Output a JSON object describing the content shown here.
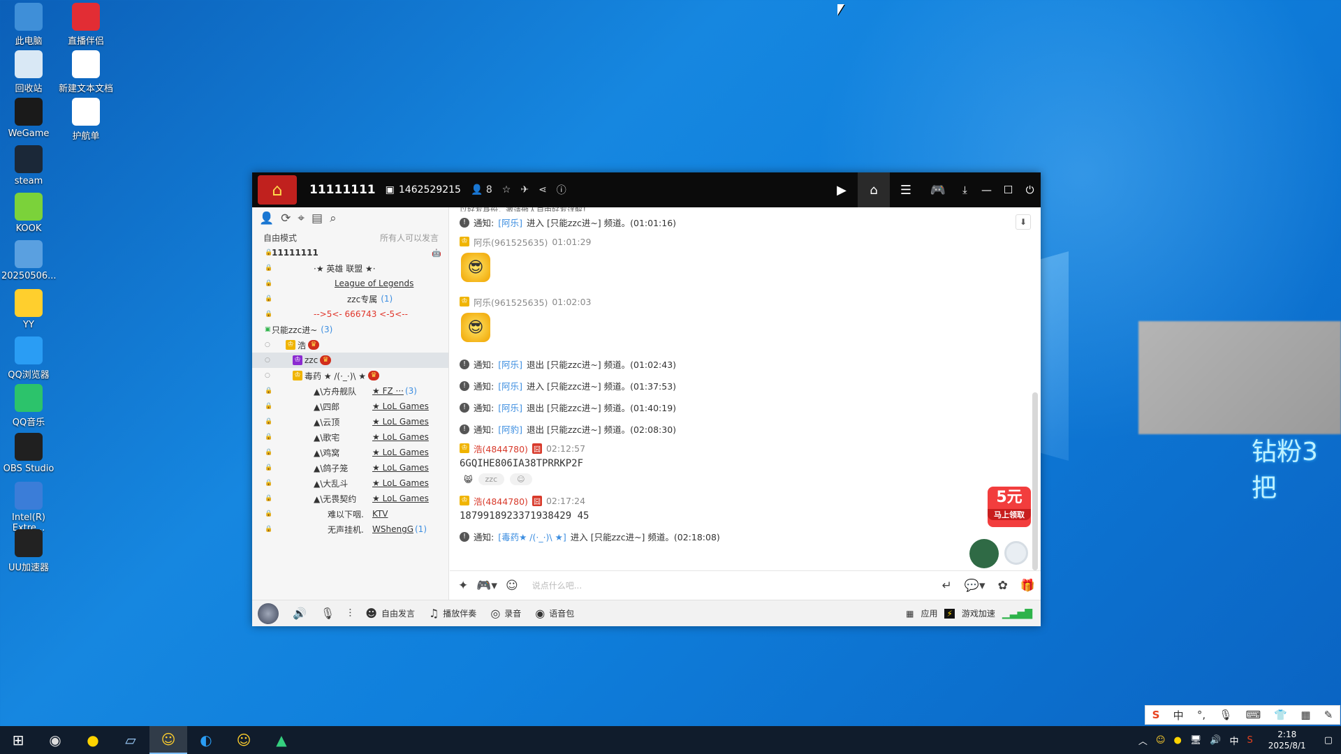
{
  "desktop": {
    "icons": [
      {
        "label": "此电脑",
        "icon": "computer-icon",
        "color": "#3f8fd8"
      },
      {
        "label": "直播伴侣",
        "icon": "live-companion-icon",
        "color": "#e22d34"
      },
      {
        "label": "回收站",
        "icon": "recycle-bin-icon",
        "color": "#d9e8f5"
      },
      {
        "label": "新建文本文档",
        "icon": "text-document-icon",
        "color": "#ffffff"
      },
      {
        "label": "WeGame",
        "icon": "wegame-icon",
        "color": "#1a1a1a"
      },
      {
        "label": "护航单",
        "icon": "text-document-icon",
        "color": "#ffffff"
      },
      {
        "label": "steam",
        "icon": "steam-icon",
        "color": "#1b2838"
      },
      {
        "label": "KOOK",
        "icon": "kook-icon",
        "color": "#7bd23a"
      },
      {
        "label": "20250506...",
        "icon": "folder-icon",
        "color": "#5aa0e0"
      },
      {
        "label": "YY",
        "icon": "yy-icon",
        "color": "#ffcf2d"
      },
      {
        "label": "QQ浏览器",
        "icon": "qq-browser-icon",
        "color": "#2a9df4"
      },
      {
        "label": "QQ音乐",
        "icon": "qq-music-icon",
        "color": "#2cc36b"
      },
      {
        "label": "OBS Studio",
        "icon": "obs-icon",
        "color": "#202020"
      },
      {
        "label": "Intel(R) Extre...",
        "icon": "intel-icon",
        "color": "#3b7dd8"
      },
      {
        "label": "UU加速器",
        "icon": "uu-accelerator-icon",
        "color": "#222222"
      }
    ],
    "side_text": "钻粉3把"
  },
  "window": {
    "room_name": "11111111",
    "room_id": "1462529215",
    "member_count": "8",
    "left": {
      "mode": "自由模式",
      "mode_note": "所有人可以发言",
      "channels": [
        {
          "text": "11111111",
          "bold": true,
          "indent": 0
        },
        {
          "text": "·★   英雄 联盟   ★·",
          "indent": 60
        },
        {
          "text": "League of Legends",
          "underline": true,
          "indent": 90
        },
        {
          "text": "zzc专属",
          "count": "(1)",
          "indent": 108
        },
        {
          "text": "-->5<-   666743   <-5<--",
          "red": true,
          "indent": 60
        },
        {
          "text": "只能zzc进~",
          "count": "(3)",
          "indent": 0,
          "folder": true
        },
        {
          "text": "浩",
          "indent": 20,
          "user": "king"
        },
        {
          "text": "zzc",
          "indent": 30,
          "user": "purple",
          "selected": true
        },
        {
          "text": "毒药 ★ /(·_·)\\ ★",
          "indent": 30,
          "user": "king"
        },
        {
          "text": "▲\\方舟舰队",
          "right": "★ FZ ···",
          "count": "(3)",
          "indent": 60
        },
        {
          "text": "▲\\四郎",
          "right": "★ LoL Games",
          "indent": 60
        },
        {
          "text": "▲\\云顶",
          "right": "★ LoL Games",
          "indent": 60
        },
        {
          "text": "▲\\歌宅",
          "right": "★ LoL Games",
          "indent": 60
        },
        {
          "text": "▲\\鸡窝",
          "right": "★ LoL Games",
          "indent": 60
        },
        {
          "text": "▲\\鸽子笼",
          "right": "★ LoL Games",
          "indent": 60
        },
        {
          "text": "▲\\大乱斗",
          "right": "★ LoL Games",
          "indent": 60
        },
        {
          "text": "▲\\无畏契约",
          "right": "★ LoL Games",
          "indent": 60
        },
        {
          "text": "难以下咽.",
          "right": "KTV",
          "indent": 80
        },
        {
          "text": "无声挂机.",
          "right": "WShengG",
          "count": "(1)",
          "indent": 80
        }
      ]
    },
    "chat": {
      "top_cut": "以好友身份，邀请他人自由好友详解！",
      "messages": [
        {
          "type": "sys",
          "label": "通知:",
          "user": "[阿乐]",
          "action": "进入 [只能zzc进~] 频道。(01:01:16)"
        },
        {
          "type": "user",
          "name": "阿乐(961525635)",
          "time": "01:01:29",
          "emoji": true
        },
        {
          "type": "user",
          "name": "阿乐(961525635)",
          "time": "01:02:03",
          "emoji": true
        },
        {
          "type": "sys",
          "label": "通知:",
          "user": "[阿乐]",
          "action": "退出 [只能zzc进~] 频道。(01:02:43)"
        },
        {
          "type": "sys",
          "label": "通知:",
          "user": "[阿乐]",
          "action": "进入 [只能zzc进~] 频道。(01:37:53)"
        },
        {
          "type": "sys",
          "label": "通知:",
          "user": "[阿乐]",
          "action": "退出 [只能zzc进~] 频道。(01:40:19)"
        },
        {
          "type": "sys",
          "label": "通知:",
          "user": "[阿豹]",
          "action": "退出 [只能zzc进~] 频道。(02:08:30)"
        },
        {
          "type": "user",
          "name": "浩(4844780)",
          "red": true,
          "time": "02:12:57",
          "text": "6GQIHE806IA38TPRRKP2F",
          "reacts": [
            "zzc"
          ]
        },
        {
          "type": "user",
          "name": "浩(4844780)",
          "red": true,
          "time": "02:17:24",
          "text": "1879918923371938429 45"
        },
        {
          "type": "sys",
          "label": "通知:",
          "user": "[毒药★ /(·_·)\\ ★]",
          "action": "进入 [只能zzc进~] 频道。(02:18:08)"
        }
      ],
      "promo_value": "5元",
      "promo_label": "马上领取"
    },
    "input": {
      "placeholder": "说点什么吧..."
    },
    "bottom": {
      "free_speak": "自由发言",
      "accompany": "播放伴奏",
      "record": "录音",
      "voice_pack": "语音包",
      "apps": "应用",
      "game_boost": "游戏加速"
    }
  },
  "taskbar": {
    "time": "2:18",
    "date": "2025/8/1",
    "ime_lang": "中"
  }
}
